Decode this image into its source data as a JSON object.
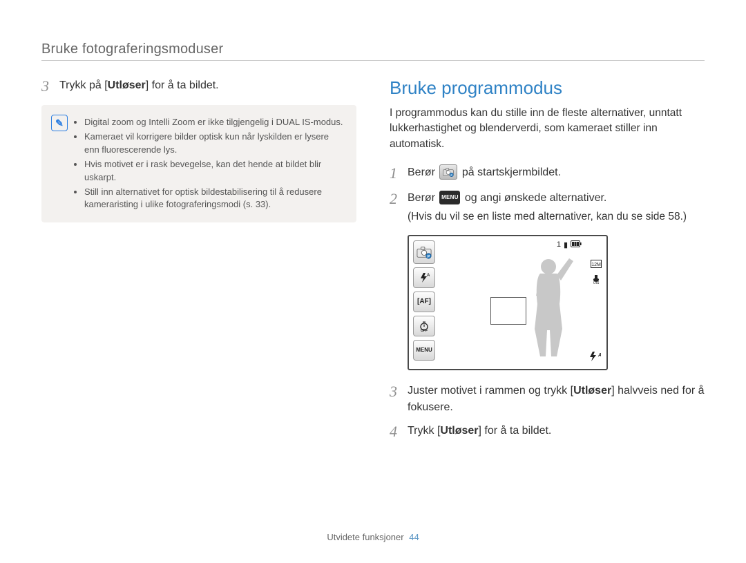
{
  "breadcrumb": "Bruke fotograferingsmoduser",
  "left": {
    "step3_num": "3",
    "step3_pre": "Trykk på ",
    "step3_key": "Utløser",
    "step3_post": " for å ta bildet.",
    "note_icon_glyph": "✎",
    "notes": [
      "Digital zoom og Intelli Zoom er ikke tilgjengelig i DUAL IS-modus.",
      "Kameraet vil korrigere bilder optisk kun når lyskilden er lysere enn fluorescerende lys.",
      "Hvis motivet er i rask bevegelse, kan det hende at bildet blir uskarpt.",
      "Still inn alternativet for optisk bildestabilisering til å redusere kameraristing i ulike fotograferingsmodi (s. 33)."
    ]
  },
  "right": {
    "title": "Bruke programmodus",
    "intro": "I programmodus kan du stille inn de fleste alternativer, unntatt lukkerhastighet og blenderverdi, som kameraet stiller inn automatisk.",
    "step1_num": "1",
    "step1_pre": "Berør ",
    "step1_post": " på startskjermbildet.",
    "step2_num": "2",
    "step2_pre": "Berør ",
    "step2_menu_label": "MENU",
    "step2_post": " og angi ønskede alternativer.",
    "step2_sub": "(Hvis du vil se en liste med alternativer, kan du se side 58.)",
    "step3_num": "3",
    "step3_pre": "Juster motivet i rammen og trykk ",
    "step3_key": "Utløser",
    "step3_post": " halvveis ned for å fokusere.",
    "step4_num": "4",
    "step4_pre": "Trykk ",
    "step4_key": "Utløser",
    "step4_post": " for å ta bildet.",
    "screen": {
      "counter": "1",
      "card_glyph": "▮",
      "battery_glyph": "▥",
      "menu_label": "MENU",
      "flash_label": "ƒᴬ",
      "af_label": "[AF]",
      "timer_label": "⏱",
      "br_label": "ƒᴬ"
    }
  },
  "footer": {
    "section": "Utvidete funksjoner",
    "page": "44"
  }
}
